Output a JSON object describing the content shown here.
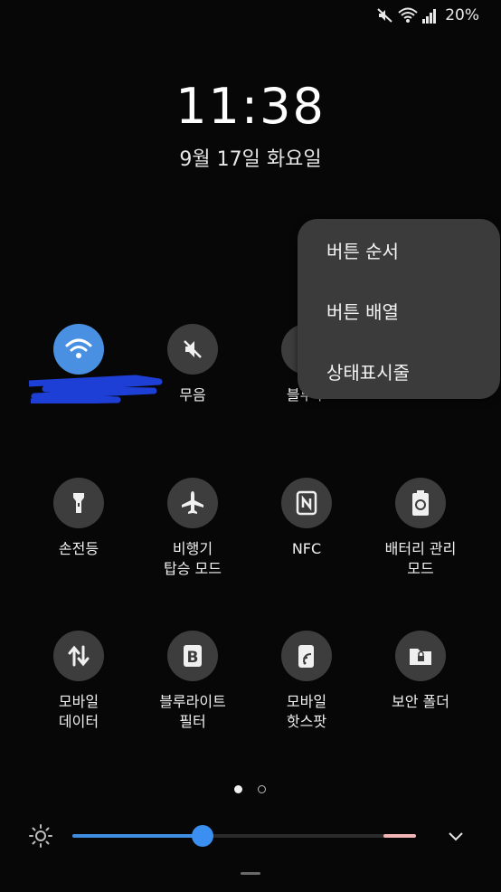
{
  "status_bar": {
    "battery": "20%",
    "icons": [
      "mute-icon",
      "wifi-icon",
      "signal-icon"
    ]
  },
  "lockscreen": {
    "time": "11:38",
    "date": "9월 17일 화요일"
  },
  "quick_panel": {
    "row1": [
      {
        "label": "",
        "icon": "wifi-icon",
        "active": true
      },
      {
        "label": "무음",
        "icon": "mute-icon",
        "active": false
      },
      {
        "label": "블루투",
        "icon": "bluetooth-icon",
        "active": false
      }
    ],
    "row2": [
      {
        "label": "손전등",
        "icon": "flashlight-icon"
      },
      {
        "label": "비행기\n탑승 모드",
        "icon": "airplane-icon"
      },
      {
        "label": "NFC",
        "icon": "nfc-icon"
      },
      {
        "label": "배터리 관리\n모드",
        "icon": "battery-saver-icon"
      }
    ],
    "row3": [
      {
        "label": "모바일\n데이터",
        "icon": "mobile-data-icon"
      },
      {
        "label": "블루라이트\n필터",
        "icon": "blue-light-filter-icon"
      },
      {
        "label": "모바일\n핫스팟",
        "icon": "hotspot-icon"
      },
      {
        "label": "보안 폴더",
        "icon": "secure-folder-icon"
      }
    ]
  },
  "menu": {
    "items": [
      "버튼 순서",
      "버튼 배열",
      "상태표시줄"
    ]
  },
  "pager": {
    "pages": 2,
    "current": 1
  },
  "brightness": {
    "level": 0.38,
    "accent": "#3b8ff0"
  },
  "colors": {
    "active_tile": "#4a90e2",
    "tile": "#3d3d3d",
    "menu_bg": "#3b3b3b"
  }
}
